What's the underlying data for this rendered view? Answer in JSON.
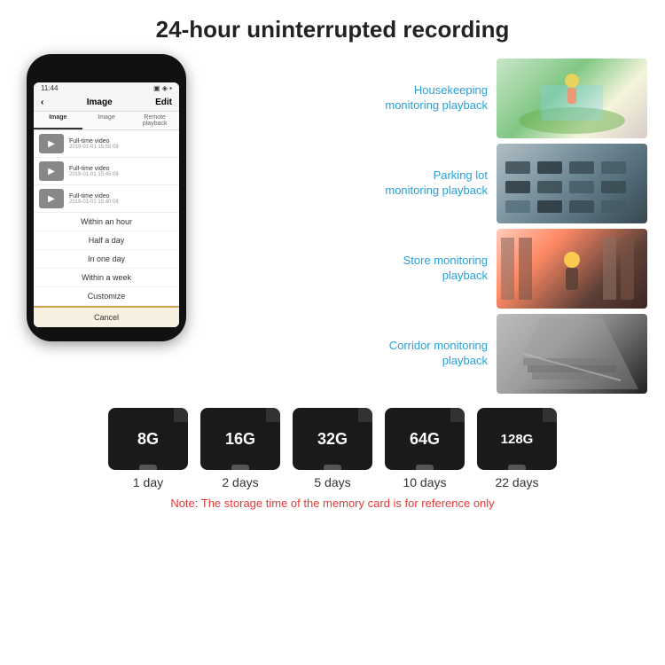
{
  "page": {
    "title": "24-hour uninterrupted recording"
  },
  "phone": {
    "status_time": "11:44",
    "header_label": "Image",
    "header_edit": "Edit",
    "tabs": [
      "Image",
      "Image",
      "Remote playback"
    ],
    "list_items": [
      {
        "label": "Full-time video",
        "time": "2019-01-01 15:55:08"
      },
      {
        "label": "Full-time video",
        "time": "2019-01-01 15:45:08"
      },
      {
        "label": "Full-time video",
        "time": "2019-01-01 15:40:08"
      }
    ],
    "dropdown_items": [
      "Within an hour",
      "Half a day",
      "In one day",
      "Within a week",
      "Customize"
    ],
    "cancel_label": "Cancel"
  },
  "monitoring": [
    {
      "label": "Housekeeping\nmonitoring playback",
      "photo_class": "photo-housekeeping"
    },
    {
      "label": "Parking lot\nmonitoring playback",
      "photo_class": "photo-parking"
    },
    {
      "label": "Store monitoring\nplayback",
      "photo_class": "photo-store"
    },
    {
      "label": "Corridor monitoring\nplayback",
      "photo_class": "photo-corridor"
    }
  ],
  "storage_cards": [
    {
      "size": "8G",
      "days": "1 day"
    },
    {
      "size": "16G",
      "days": "2 days"
    },
    {
      "size": "32G",
      "days": "5 days"
    },
    {
      "size": "64G",
      "days": "10 days"
    },
    {
      "size": "128G",
      "days": "22 days"
    }
  ],
  "storage_note": "Note: The storage time of the memory card is for reference only"
}
